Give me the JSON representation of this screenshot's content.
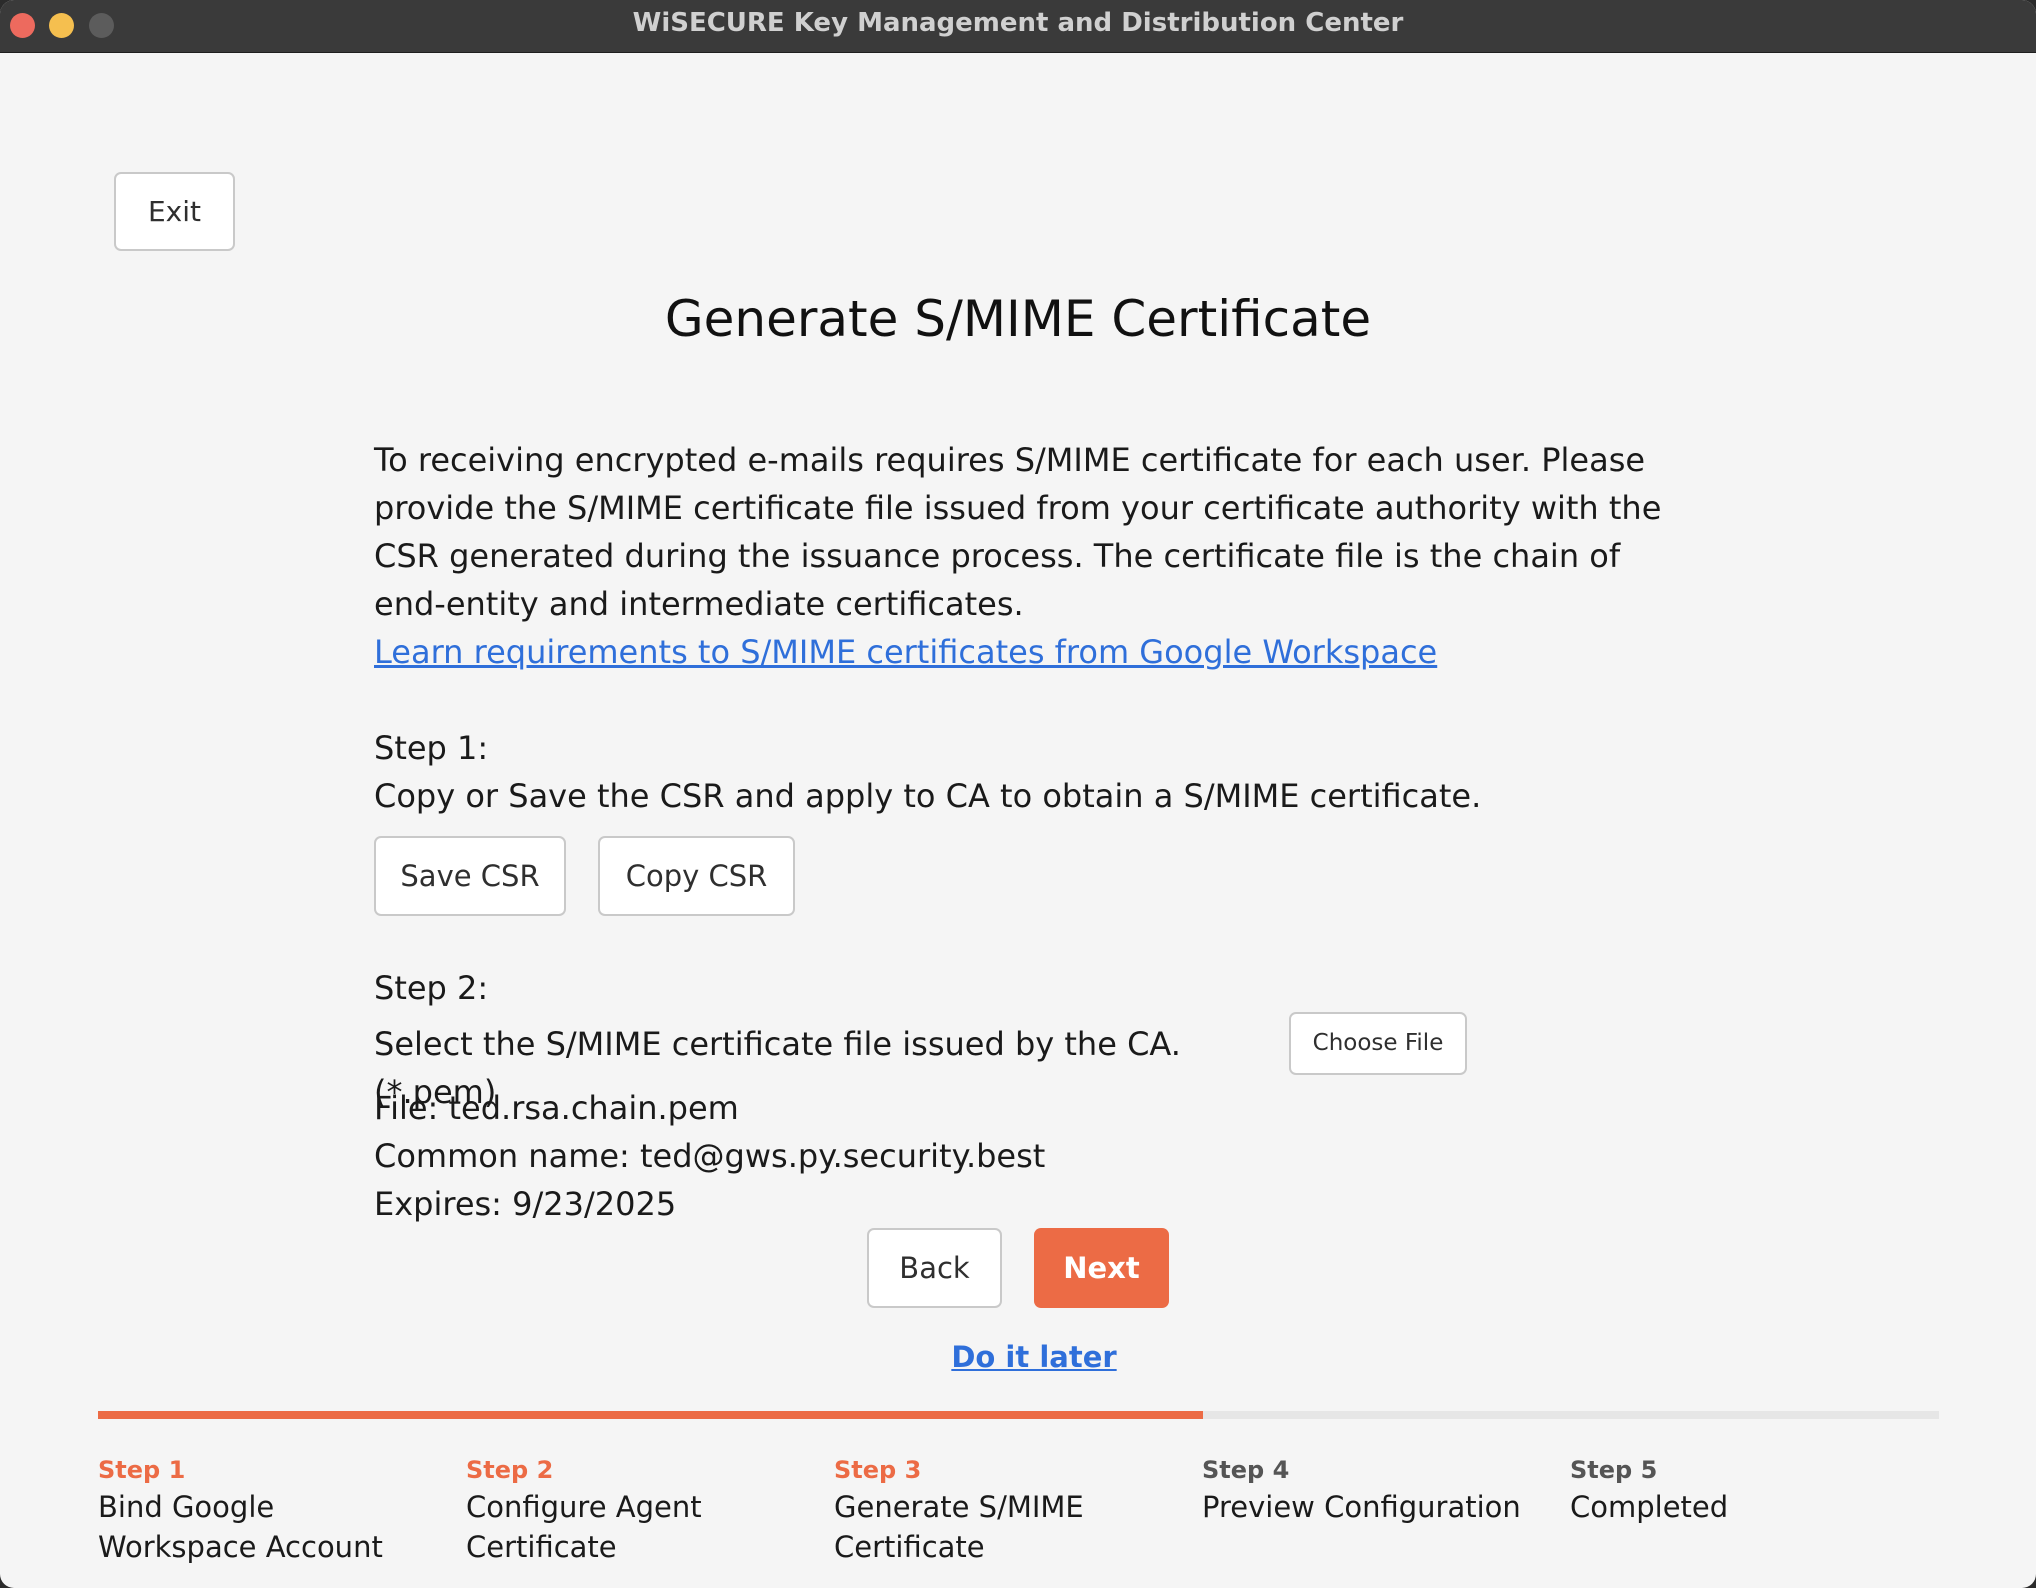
{
  "window": {
    "title": "WiSECURE Key Management and Distribution Center"
  },
  "header": {
    "exit_label": "Exit",
    "page_title": "Generate S/MIME Certificate"
  },
  "intro": {
    "text": "To receiving encrypted e-mails requires S/MIME certificate for each user. Please provide the S/MIME certificate file issued from your certificate authority with the CSR generated during the issuance process. The certificate file is the chain of end-entity and intermediate certificates.",
    "link_text": "Learn requirements to S/MIME certificates from Google Workspace"
  },
  "step1": {
    "label": "Step 1:",
    "description": "Copy or Save the CSR and apply to CA to obtain a S/MIME certificate.",
    "save_label": "Save CSR",
    "copy_label": "Copy CSR"
  },
  "step2": {
    "label": "Step 2:",
    "description": "Select the S/MIME certificate file issued by the CA. (*.pem)",
    "choose_label": "Choose File",
    "file_line": "File: ted.rsa.chain.pem",
    "common_name_line": "Common name: ted@gws.py.security.best",
    "expires_line": "Expires: 9/23/2025"
  },
  "nav": {
    "back_label": "Back",
    "next_label": "Next",
    "later_label": "Do it later"
  },
  "progress": {
    "fraction": 0.6,
    "steps": [
      {
        "num": "Step 1",
        "label": "Bind Google\nWorkspace Account"
      },
      {
        "num": "Step 2",
        "label": "Configure Agent\nCertificate"
      },
      {
        "num": "Step 3",
        "label": "Generate S/MIME\nCertificate"
      },
      {
        "num": "Step 4",
        "label": "Preview Configuration"
      },
      {
        "num": "Step 5",
        "label": "Completed"
      }
    ]
  },
  "colors": {
    "accent": "#ec6b45",
    "link": "#2f6fda"
  },
  "icons": {
    "close": "close-window-icon",
    "minimize": "minimize-window-icon",
    "zoom": "zoom-window-icon"
  }
}
